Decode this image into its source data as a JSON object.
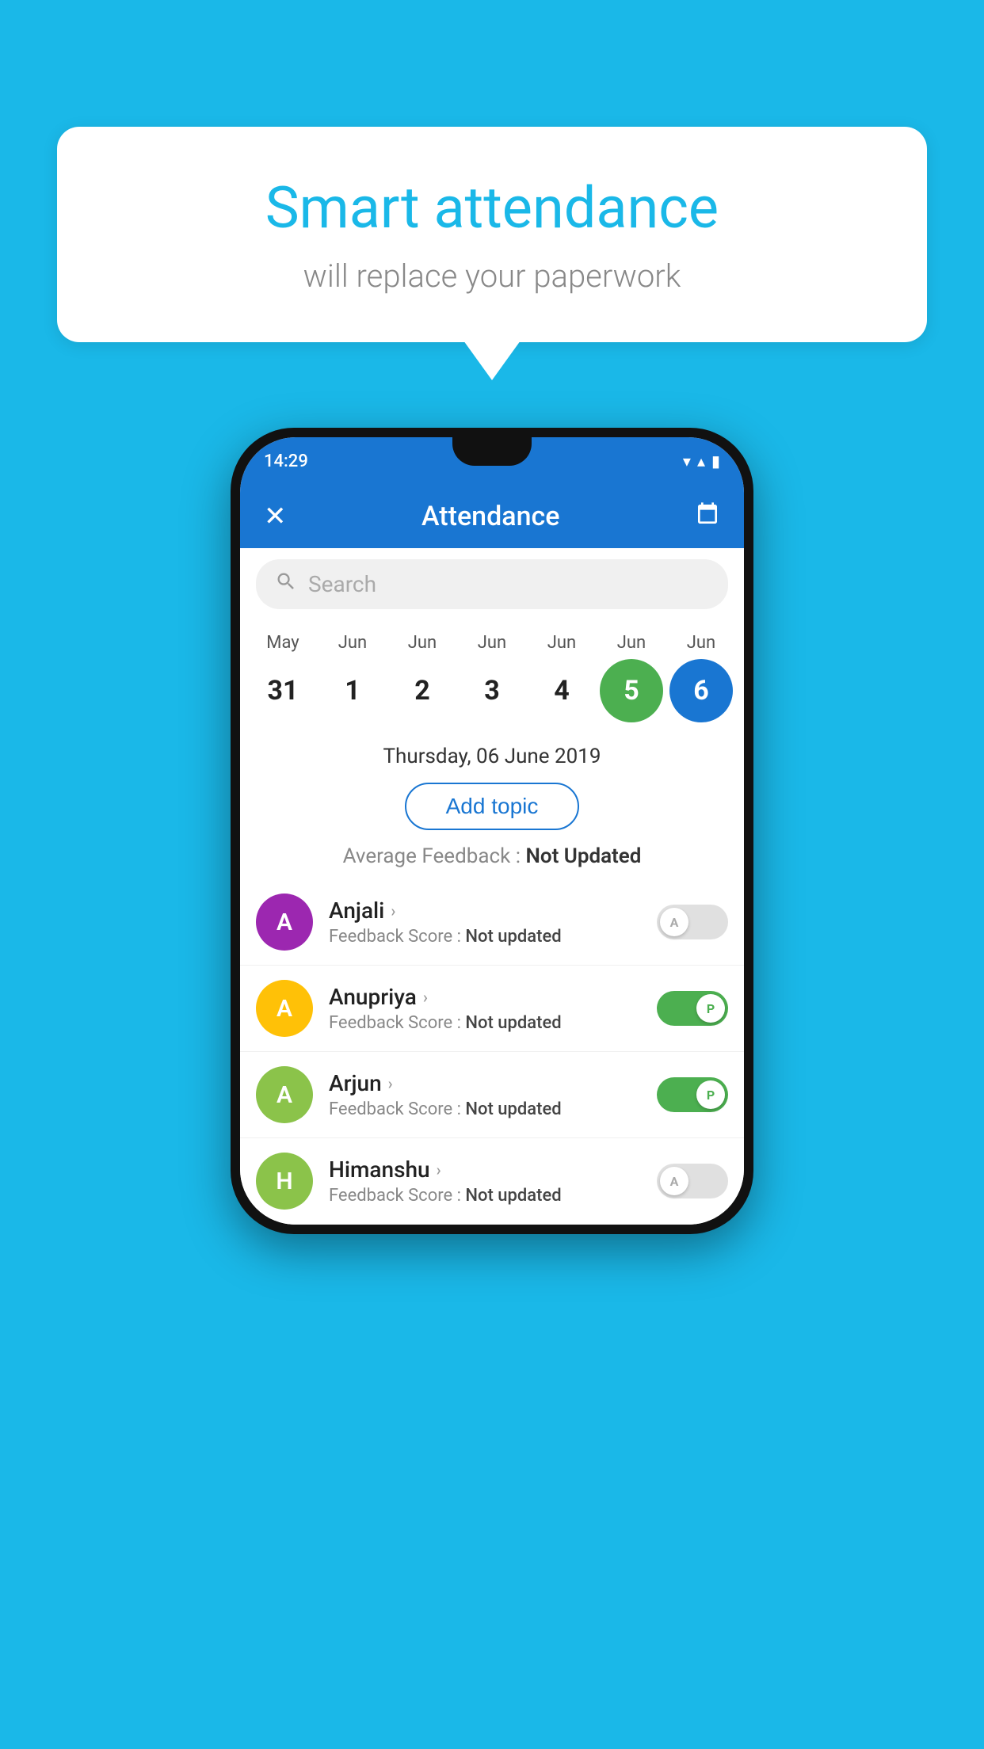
{
  "background_color": "#1ab8e8",
  "speech_bubble": {
    "title": "Smart attendance",
    "subtitle": "will replace your paperwork"
  },
  "status_bar": {
    "time": "14:29",
    "wifi_icon": "▼",
    "signal_icon": "▲",
    "battery_icon": "▮"
  },
  "app_header": {
    "close_label": "✕",
    "title": "Attendance",
    "calendar_icon": "📅"
  },
  "search": {
    "placeholder": "Search"
  },
  "calendar": {
    "months": [
      "May",
      "Jun",
      "Jun",
      "Jun",
      "Jun",
      "Jun",
      "Jun"
    ],
    "dates": [
      {
        "day": "31",
        "state": "normal"
      },
      {
        "day": "1",
        "state": "normal"
      },
      {
        "day": "2",
        "state": "normal"
      },
      {
        "day": "3",
        "state": "normal"
      },
      {
        "day": "4",
        "state": "normal"
      },
      {
        "day": "5",
        "state": "today"
      },
      {
        "day": "6",
        "state": "selected"
      }
    ]
  },
  "selected_date": "Thursday, 06 June 2019",
  "add_topic_label": "Add topic",
  "average_feedback": {
    "label": "Average Feedback : ",
    "value": "Not Updated"
  },
  "students": [
    {
      "name": "Anjali",
      "avatar_letter": "A",
      "avatar_color": "#9c27b0",
      "feedback_label": "Feedback Score : ",
      "feedback_value": "Not updated",
      "toggle_state": "off",
      "toggle_letter": "A"
    },
    {
      "name": "Anupriya",
      "avatar_letter": "A",
      "avatar_color": "#ffc107",
      "feedback_label": "Feedback Score : ",
      "feedback_value": "Not updated",
      "toggle_state": "on",
      "toggle_letter": "P"
    },
    {
      "name": "Arjun",
      "avatar_letter": "A",
      "avatar_color": "#8bc34a",
      "feedback_label": "Feedback Score : ",
      "feedback_value": "Not updated",
      "toggle_state": "on",
      "toggle_letter": "P"
    },
    {
      "name": "Himanshu",
      "avatar_letter": "H",
      "avatar_color": "#8bc34a",
      "feedback_label": "Feedback Score : ",
      "feedback_value": "Not updated",
      "toggle_state": "off",
      "toggle_letter": "A"
    }
  ]
}
